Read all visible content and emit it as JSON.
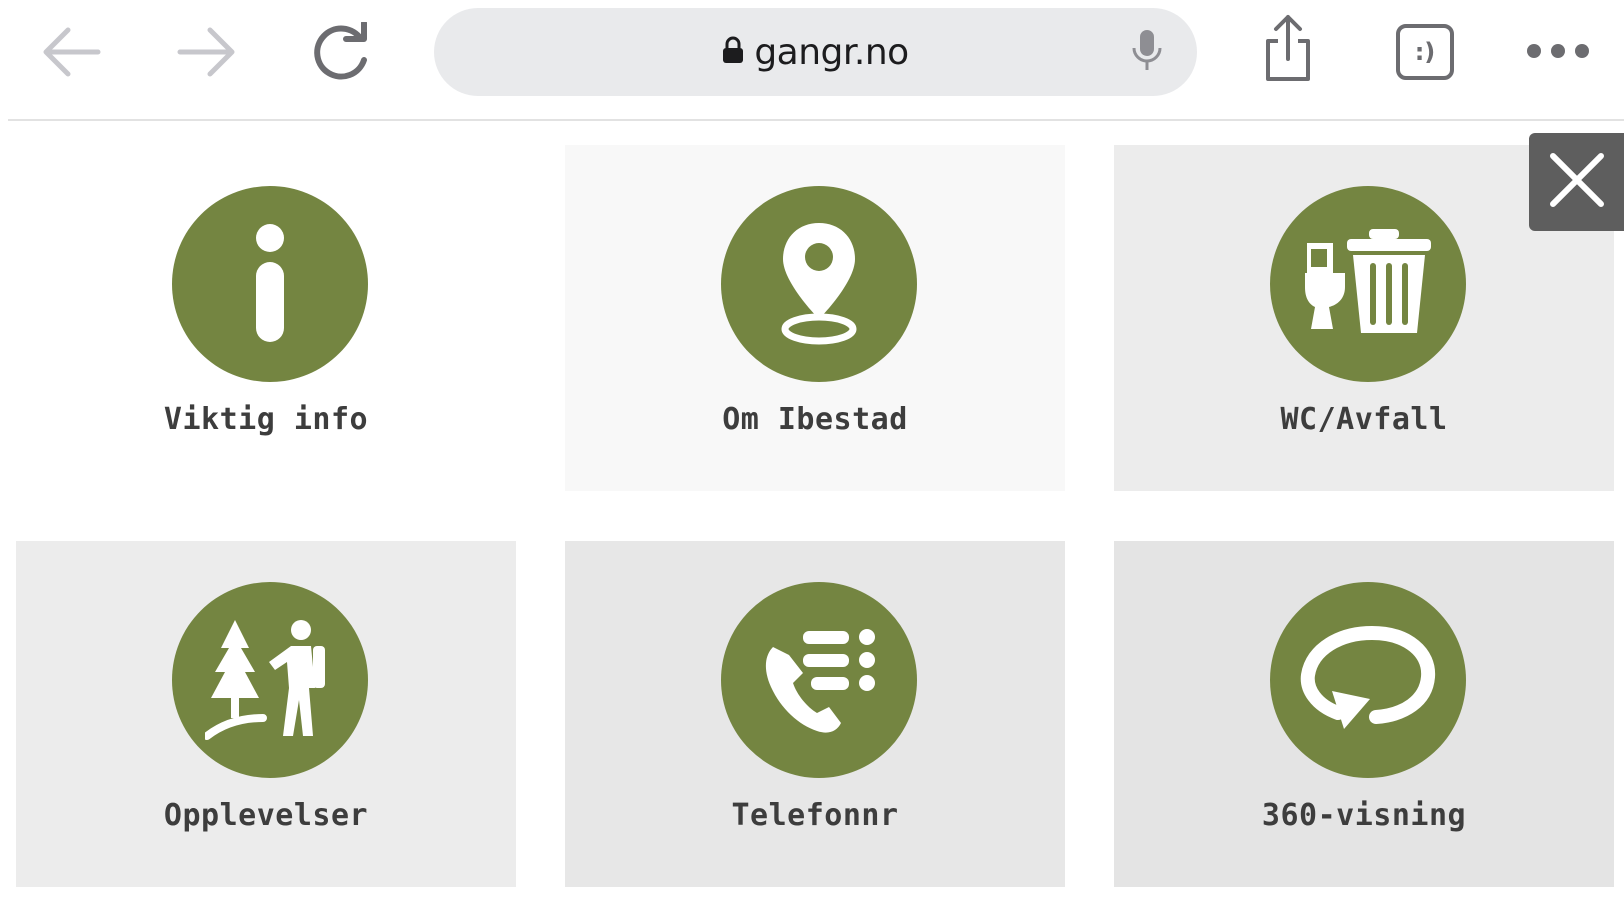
{
  "browser": {
    "url": "gangr.no",
    "icons": {
      "back": "arrow-left-icon",
      "forward": "arrow-right-icon",
      "reload": "reload-icon",
      "lock": "lock-icon",
      "mic": "microphone-icon",
      "share": "share-icon",
      "tabs": "tab-switcher-icon",
      "more": "more-dots-icon"
    },
    "tab_switcher_label": ":)"
  },
  "theme": {
    "accent": "#748541",
    "tile_bg_light": "#f8f8f8",
    "tile_bg_mid": "#ececec",
    "tile_bg_dark": "#e4e4e4",
    "label_color": "#3d3d3d",
    "close_bg": "#5e5e5e"
  },
  "menu": {
    "tiles": [
      {
        "label": "Viktig info",
        "icon": "info-icon"
      },
      {
        "label": "Om Ibestad",
        "icon": "location-pin-icon"
      },
      {
        "label": "WC/Avfall",
        "icon": "toilet-trash-icon"
      },
      {
        "label": "Opplevelser",
        "icon": "hiker-tree-icon"
      },
      {
        "label": "Telefonnr",
        "icon": "phone-list-icon"
      },
      {
        "label": "360-visning",
        "icon": "rotate-360-icon"
      }
    ],
    "close_icon": "close-icon"
  }
}
